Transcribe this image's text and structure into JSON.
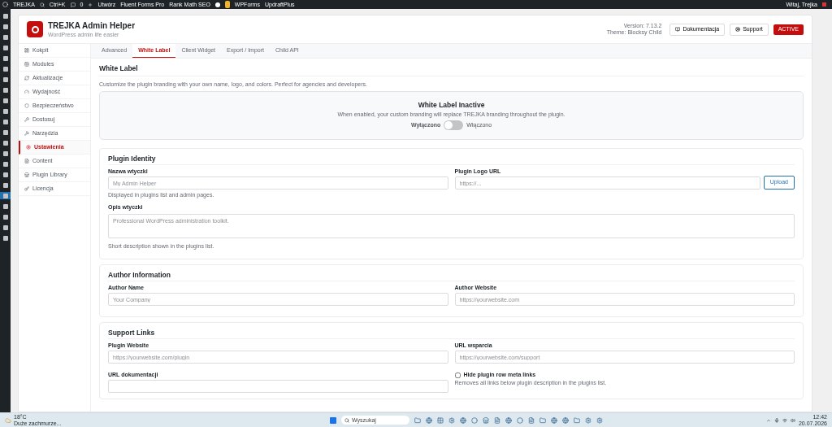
{
  "admin_bar": {
    "site": "TREJKA",
    "search": "Ctrl+K",
    "comments": "0",
    "new": "Utwórz",
    "items": [
      "Fluent Forms Pro",
      "Rank Math SEO"
    ],
    "items_after": [
      "WPForms",
      "UpdraftPlus"
    ],
    "greeting": "Witaj, Trejka"
  },
  "admin_menu": [
    {
      "selected": false
    },
    {
      "selected": false
    },
    {
      "selected": false
    },
    {
      "selected": false
    },
    {
      "selected": false
    },
    {
      "selected": false
    },
    {
      "selected": false
    },
    {
      "selected": false
    },
    {
      "selected": false
    },
    {
      "selected": false
    },
    {
      "selected": false
    },
    {
      "selected": false
    },
    {
      "selected": false
    },
    {
      "selected": false
    },
    {
      "selected": false
    },
    {
      "selected": false
    },
    {
      "selected": false
    },
    {
      "selected": true
    },
    {
      "selected": false
    },
    {
      "selected": false
    },
    {
      "selected": false
    },
    {
      "selected": false
    }
  ],
  "plugin_header": {
    "title": "TREJKA Admin Helper",
    "subtitle": "WordPress admin life easier",
    "version": "Version: 7.13.2",
    "theme": "Theme: Blocksy Child",
    "buttons": [
      "Dokumentacja",
      "Support"
    ],
    "status": "ACTIVE"
  },
  "nav": [
    {
      "label": "Kokpit",
      "selected": false
    },
    {
      "label": "Modules",
      "selected": false
    },
    {
      "label": "Aktualizacje",
      "selected": false
    },
    {
      "label": "Wydajność",
      "selected": false
    },
    {
      "label": "Bezpieczeństwo",
      "selected": false
    },
    {
      "label": "Dostosuj",
      "selected": false
    },
    {
      "label": "Narzędzia",
      "selected": false
    },
    {
      "label": "Ustawienia",
      "selected": true
    },
    {
      "label": "Content",
      "selected": false
    },
    {
      "label": "Plugin Library",
      "selected": false
    },
    {
      "label": "Licencja",
      "selected": false
    }
  ],
  "tabs": [
    {
      "label": "Advanced",
      "selected": false
    },
    {
      "label": "White Label",
      "selected": true
    },
    {
      "label": "Client Widget",
      "selected": false
    },
    {
      "label": "Export / Import",
      "selected": false
    },
    {
      "label": "Child API",
      "selected": false
    }
  ],
  "section": {
    "title": "White Label",
    "description": "Customize the plugin branding with your own name, logo, and colors. Perfect for agencies and developers."
  },
  "status_card": {
    "title": "White Label Inactive",
    "text": "When enabled, your custom branding will replace TREJKA branding throughout the plugin.",
    "off_label": "Wyłączono",
    "on_label": "Włączono",
    "on": false
  },
  "plugin_identity": {
    "title": "Plugin Identity",
    "name_label": "Nazwa wtyczki",
    "name_placeholder": "My Admin Helper",
    "name_help": "Displayed in plugins list and admin pages.",
    "logo_label": "Plugin Logo URL",
    "logo_placeholder": "https://...",
    "upload": "Upload",
    "desc_label": "Opis wtyczki",
    "desc_placeholder": "Professional WordPress administration toolkit.",
    "desc_help": "Short description shown in the plugins list."
  },
  "author": {
    "title": "Author Information",
    "fields": [
      {
        "label": "Author Name",
        "placeholder": "Your Company"
      },
      {
        "label": "Author Website",
        "placeholder": "https://yourwebsite.com"
      }
    ]
  },
  "support": {
    "title": "Support Links",
    "fields": [
      {
        "label": "Plugin Website",
        "placeholder": "https://yourwebsite.com/plugin"
      },
      {
        "label": "URL wsparcia",
        "placeholder": "https://yourwebsite.com/support"
      }
    ],
    "docs_label": "URL dokumentacji",
    "hide_meta": {
      "label": "Hide plugin row meta links",
      "checked": false,
      "help": "Removes all links below plugin description in the plugins list."
    }
  },
  "taskbar": {
    "temperature": "18°C",
    "weather": "Duże zachmurze...",
    "search": "Wyszukaj",
    "time": "12:42",
    "date": "20.07.2026"
  }
}
